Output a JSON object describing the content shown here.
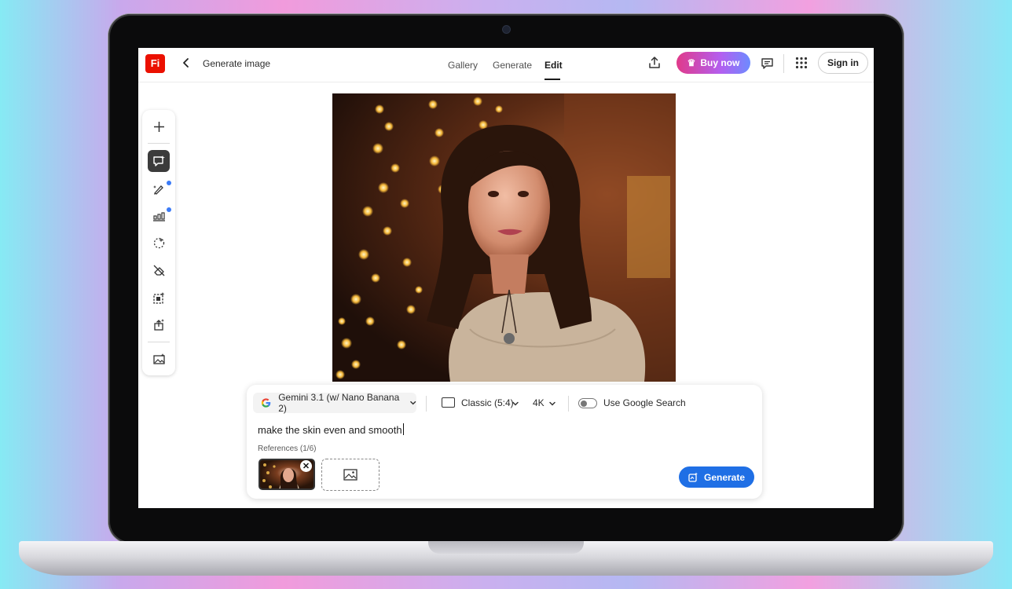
{
  "app": {
    "logo_text": "Fi",
    "page_title": "Generate image"
  },
  "header": {
    "tabs": [
      {
        "label": "Gallery"
      },
      {
        "label": "Generate"
      },
      {
        "label": "Edit"
      }
    ],
    "active_tab": "Edit",
    "buy_label": "Buy now",
    "signin_label": "Sign in"
  },
  "toolbar": {
    "tools": [
      {
        "icon": "plus-icon"
      },
      {
        "icon": "prompt-edit-icon",
        "active": true
      },
      {
        "icon": "brush-sparkle-icon",
        "badge": true
      },
      {
        "icon": "adjust-sliders-icon",
        "badge": true
      },
      {
        "icon": "remove-background-icon"
      },
      {
        "icon": "eraser-icon"
      },
      {
        "icon": "expand-image-icon"
      },
      {
        "icon": "upscale-icon"
      },
      {
        "icon": "image-sparkle-icon"
      }
    ]
  },
  "prompt_panel": {
    "model": "Gemini 3.1 (w/ Nano Banana 2)",
    "aspect_ratio": "Classic (5:4)",
    "resolution": "4K",
    "google_search_label": "Use Google Search",
    "google_search_enabled": false,
    "prompt": "make the skin even and smooth",
    "references_label": "References (1/6)",
    "generate_label": "Generate"
  },
  "colors": {
    "brand": "#eb1000",
    "generate_button": "#1f6fe5",
    "badge_dot": "#3b7bf7"
  }
}
